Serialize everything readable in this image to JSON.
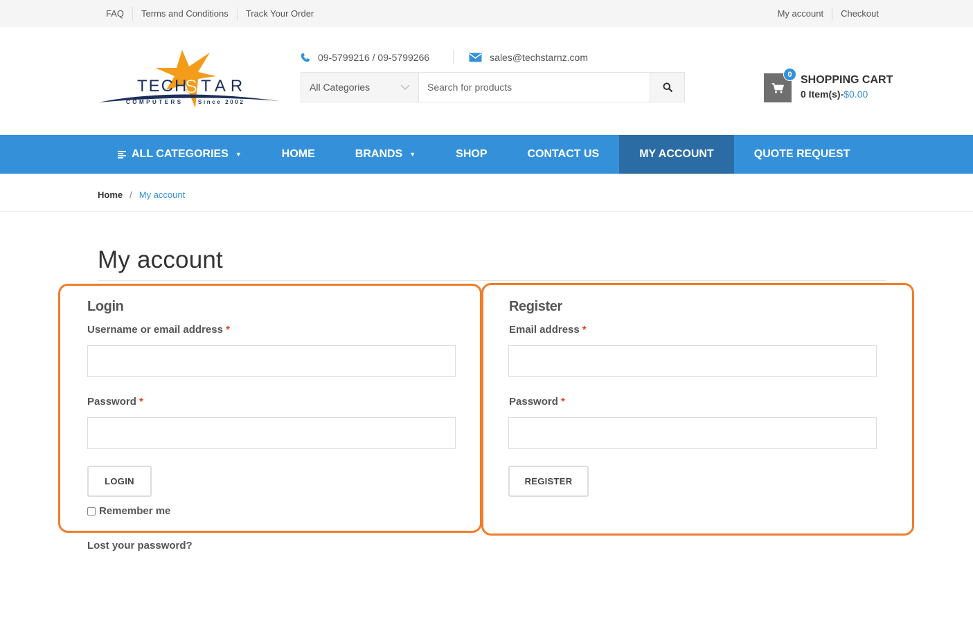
{
  "topbar": {
    "left_links": [
      "FAQ",
      "Terms and Conditions",
      "Track Your Order"
    ],
    "right_links": [
      "My account",
      "Checkout"
    ]
  },
  "brand": {
    "name_left": "TECH",
    "name_s": "S",
    "name_right": "TAR",
    "tagline_left": "COMPUTERS",
    "tagline_right": "Since 2002",
    "colors": {
      "star": "#f39c19",
      "navy": "#1b2f5c",
      "accent": "#3491d9"
    }
  },
  "contact": {
    "phone": "09-5799216 / 09-5799266",
    "email": "sales@techstarnz.com",
    "phone_icon": "phone-icon",
    "email_icon": "envelope-icon"
  },
  "search": {
    "category_selected": "All Categories",
    "placeholder": "Search for products",
    "button_icon": "search-icon"
  },
  "cart": {
    "count": "0",
    "title": "SHOPPING CART",
    "items_text": "0 Item(s)-",
    "amount": "$0.00",
    "icon": "cart-icon"
  },
  "nav": {
    "all_categories": "ALL CATEGORIES",
    "home": "HOME",
    "brands": "BRANDS",
    "shop": "SHOP",
    "contact": "CONTACT US",
    "my_account": "MY ACCOUNT",
    "quote": "QUOTE REQUEST"
  },
  "breadcrumb": {
    "home": "Home",
    "separator": "/",
    "current": "My account"
  },
  "page_title": "My account",
  "login": {
    "heading": "Login",
    "username_label": "Username or email address",
    "password_label": "Password",
    "required": "*",
    "button": "LOGIN",
    "remember": "Remember me",
    "lost_password": "Lost your password?"
  },
  "register": {
    "heading": "Register",
    "email_label": "Email address",
    "password_label": "Password",
    "required": "*",
    "button": "REGISTER"
  },
  "highlight_color": "#f07d2b"
}
